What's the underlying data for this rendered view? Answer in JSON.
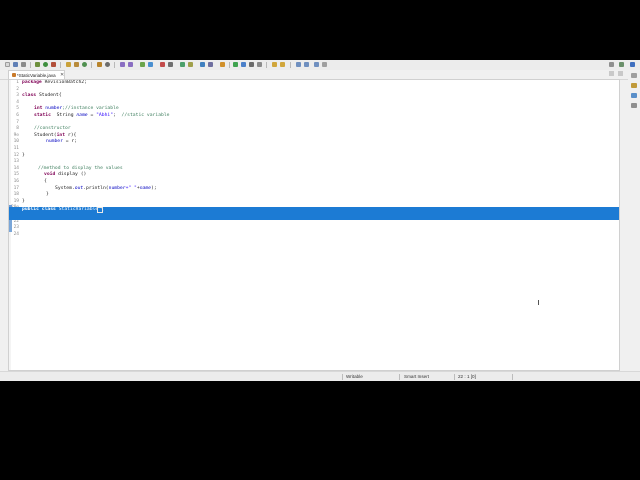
{
  "editor_tab": {
    "title": "*StaticVariable.java",
    "close_glyph": "✕"
  },
  "code": {
    "line_numbers": [
      "1",
      "2",
      "3",
      "4",
      "5",
      "6",
      "7",
      "8",
      "9⊖",
      "10",
      "11",
      "12",
      "13",
      "14",
      "15",
      "16",
      "17",
      "18",
      "19",
      "20⊖",
      "21",
      "22",
      "23",
      "24"
    ],
    "lines": {
      "l1_kw": "package",
      "l1_text": " RevisionBatch2;",
      "l3_kw": "class",
      "l3_text": " Student{",
      "l5_kw": "int",
      "l5_field": "number",
      "l5_comment": ";//instance variable",
      "l6_kw": "static",
      "l6_text": "  String ",
      "l6_field": "name",
      "l6_mid": " = ",
      "l6_string": "\"Abhi\"",
      "l6_tail": ";  ",
      "l6_comment": "//static variable",
      "l8_comment": "//constructor",
      "l9_text": "Student(",
      "l9_kw": "int",
      "l9_tail": " r){",
      "l10_field": "number",
      "l10_tail": " = r;",
      "l12_text": "}",
      "l14_comment": "//method to display the values",
      "l15_kw": "void",
      "l15_text": " display ()",
      "l16_text": "{",
      "l17_text": "System.",
      "l17_out": "out",
      "l17_mid": ".println(",
      "l17_field": "number",
      "l17_plus": "+\" \"",
      "l17_plus2": "+",
      "l17_field2": "name",
      "l17_tail": ");",
      "l18_text": "}",
      "l19_text": "}",
      "l21_kw1": "public",
      "l21_sp": " ",
      "l21_kw2": "class",
      "l21_text": " StaticVariable {"
    }
  },
  "status_bar": {
    "write_mode": "Writable",
    "insert_mode": "Smart Insert",
    "position": "22 : 1 [0]"
  },
  "colors": {
    "selection": "#1c7bd4",
    "keyword": "#7f0055",
    "comment": "#3f7f5f",
    "string": "#2a00ff",
    "field": "#0000c0"
  },
  "icons": [
    "new-file-icon",
    "save-icon",
    "print-icon",
    "debug-icon",
    "run-icon",
    "external-tools-icon",
    "new-java-project-icon",
    "new-package-icon",
    "new-class-icon",
    "open-type-icon",
    "search-icon",
    "annotation-next-icon",
    "annotation-prev-icon",
    "back-icon",
    "forward-icon",
    "perspective-icon",
    "java-perspective-icon"
  ]
}
